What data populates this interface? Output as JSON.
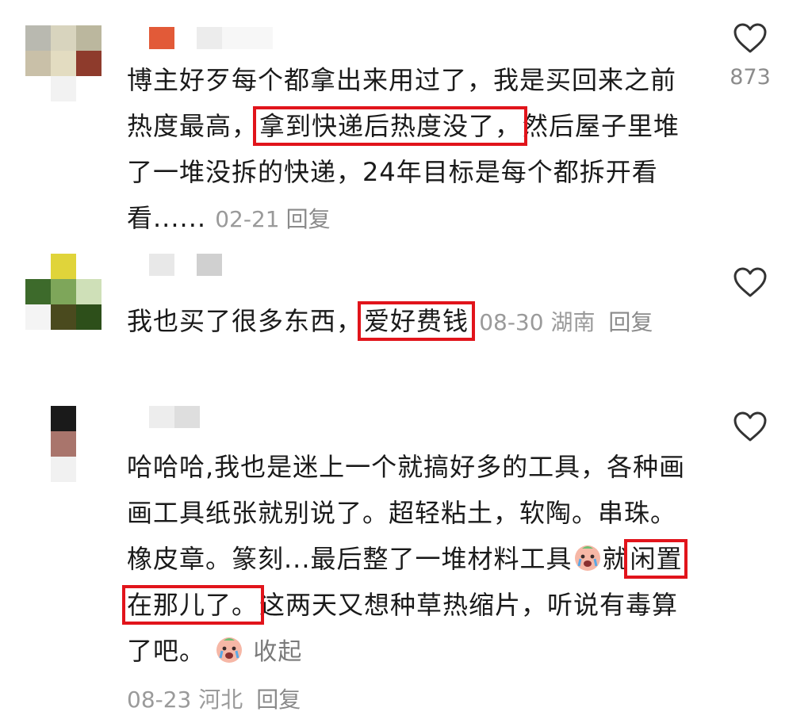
{
  "comments": [
    {
      "text_before": "博主好歹每个都拿出来用过了，我是买回来之前热度最高，",
      "highlight": "拿到快递后热度没了，",
      "text_after": "然后屋子里堆了一堆没拆的快递，24年目标是每个都拆开看看......",
      "date": "02-21",
      "reply": "回复",
      "likes": "873"
    },
    {
      "text_before": "我也买了很多东西，",
      "highlight": "爱好费钱",
      "text_after": "",
      "date": "08-30",
      "location": "湖南",
      "reply": "回复"
    },
    {
      "text_before": "哈哈哈,我也是迷上一个就搞好多的工具，各种画画工具纸张就别说了。超轻粘土，软陶。串珠。橡皮章。篆刻...最后整了一堆材料工具",
      "highlight_prefix": "就",
      "highlight": "闲置在那儿了。",
      "text_after": "这两天又想种草热缩片，听说有毒算了吧。",
      "collapse": "收起",
      "date": "08-23",
      "location": "河北",
      "reply": "回复"
    }
  ],
  "colors": {
    "highlight_border": "#e1141b",
    "meta_gray": "#9a9a9a",
    "text": "#1a1a1a"
  },
  "icons": [
    "heart-outline-icon",
    "crying-emoji-icon"
  ]
}
